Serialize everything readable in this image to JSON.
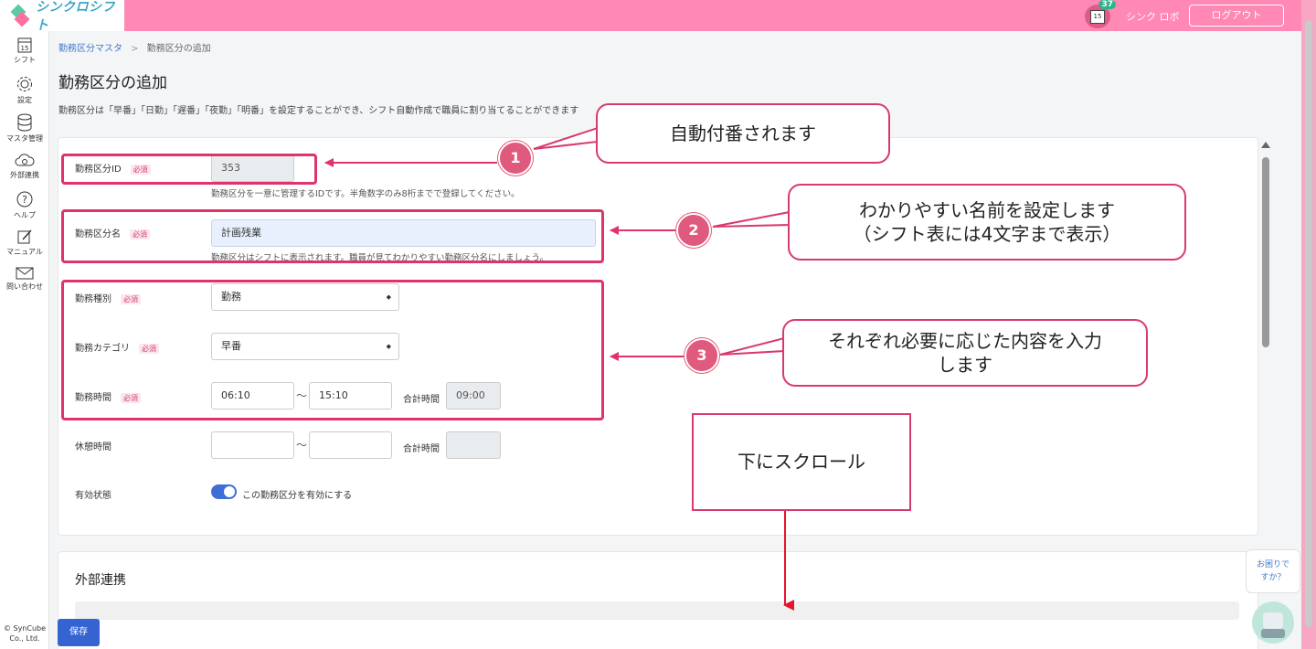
{
  "app": {
    "logo_text": "シンクロシフト",
    "user_name": "シンク ロボ",
    "logout_label": "ログアウト",
    "notification_count": "37",
    "calendar_day": "15"
  },
  "sidebar": {
    "items": [
      {
        "label": "シフト",
        "icon": "calendar-icon"
      },
      {
        "label": "設定",
        "icon": "gear-icon"
      },
      {
        "label": "マスタ管理",
        "icon": "database-icon"
      },
      {
        "label": "外部連携",
        "icon": "cloud-sync-icon"
      },
      {
        "label": "ヘルプ",
        "icon": "help-icon"
      },
      {
        "label": "マニュアル",
        "icon": "manual-icon"
      },
      {
        "label": "問い合わせ",
        "icon": "mail-icon"
      }
    ],
    "calendar_day": "15",
    "copyright_line1": "© SynCube",
    "copyright_line2": "Co., Ltd."
  },
  "breadcrumb": {
    "parent": "勤務区分マスタ",
    "separator": ">",
    "current": "勤務区分の追加"
  },
  "page": {
    "title": "勤務区分の追加",
    "description": "勤務区分は「早番」「日勤」「遅番」「夜勤」「明番」を設定することができ、シフト自動作成で職員に割り当てることができます"
  },
  "form": {
    "required_label": "必須",
    "id_field": {
      "label": "勤務区分ID",
      "value": "353",
      "hint": "勤務区分を一意に管理するIDです。半角数字のみ8桁までで登録してください。"
    },
    "name_field": {
      "label": "勤務区分名",
      "value": "計画残業",
      "hint": "勤務区分はシフトに表示されます。職員が見てわかりやすい勤務区分名にしましょう。"
    },
    "type_field": {
      "label": "勤務種別",
      "selected": "勤務"
    },
    "category_field": {
      "label": "勤務カテゴリ",
      "selected": "早番"
    },
    "work_time": {
      "label": "勤務時間",
      "start": "06:10",
      "end": "15:10",
      "tilde": "〜",
      "total_label": "合計時間",
      "total": "09:00"
    },
    "break_time": {
      "label": "休憩時間",
      "start": "",
      "end": "",
      "tilde": "〜",
      "total_label": "合計時間",
      "total": ""
    },
    "status": {
      "label": "有効状態",
      "toggle_text": "この勤務区分を有効にする",
      "enabled": true
    }
  },
  "external": {
    "title": "外部連携"
  },
  "save_label": "保存",
  "help": {
    "line1": "お困りで",
    "line2": "すか？"
  },
  "annotations": {
    "num1": "1",
    "num2": "2",
    "num3": "3",
    "callout1": "自動付番されます",
    "callout2_line1": "わかりやすい名前を設定します",
    "callout2_line2": "（シフト表には4文字まで表示）",
    "callout3_line1": "それぞれ必要に応じた内容を入力",
    "callout3_line2": "します",
    "scroll_note": "下にスクロール",
    "accent_color": "#e0336a"
  }
}
